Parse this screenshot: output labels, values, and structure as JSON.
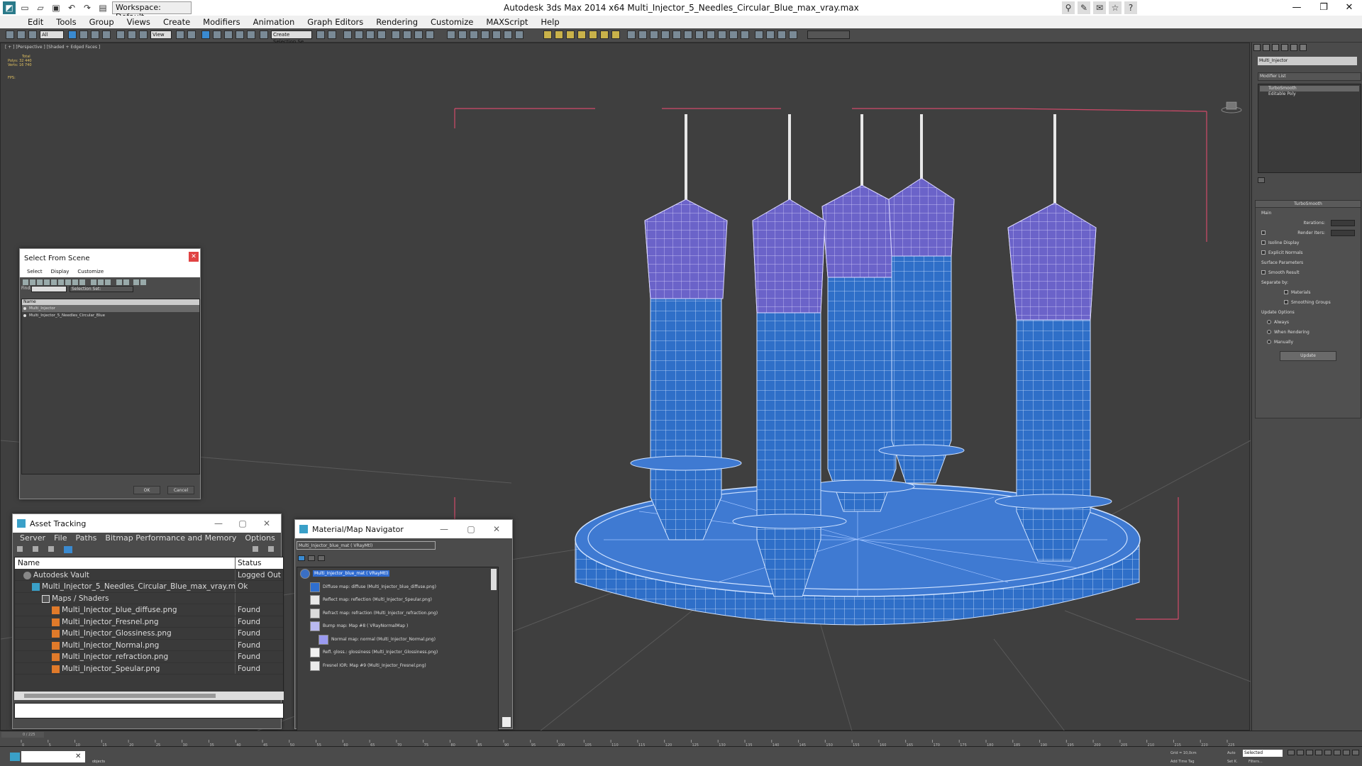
{
  "app": {
    "title": "Autodesk 3ds Max  2014 x64    Multi_Injector_5_Needles_Circular_Blue_max_vray.max",
    "workspace": "Workspace: Default"
  },
  "menu": [
    "Edit",
    "Tools",
    "Group",
    "Views",
    "Create",
    "Modifiers",
    "Animation",
    "Graph Editors",
    "Rendering",
    "Customize",
    "MAXScript",
    "Help"
  ],
  "toolbar": {
    "selection_filter": "All",
    "view": "View",
    "named_sets": "Create Selection Se"
  },
  "viewport": {
    "label": "[ + ] [Perspective ] [Shaded + Edged Faces ]",
    "stats": {
      "total": "Total",
      "polys": "Polys:  32 440",
      "verts": "Verts:  16 740",
      "fps": "FPS:"
    }
  },
  "command_panel": {
    "object_name": "Multi_Injector",
    "modifier_list": "Modifier List",
    "stack": [
      "TurboSmooth",
      "Editable Poly"
    ],
    "turbosmooth": {
      "title": "TurboSmooth",
      "main": "Main",
      "iterations": "Iterations:",
      "render_iters": "Render Iters:",
      "isoline": "Isoline Display",
      "explicit": "Explicit Normals",
      "surface": "Surface Parameters",
      "smooth": "Smooth Result",
      "separate": "Separate by:",
      "materials": "Materials",
      "groups": "Smoothing Groups",
      "update_options": "Update Options",
      "always": "Always",
      "when_rendering": "When Rendering",
      "manually": "Manually",
      "update": "Update"
    }
  },
  "select_from_scene": {
    "title": "Select From Scene",
    "menu": [
      "Select",
      "Display",
      "Customize"
    ],
    "find": "Find:",
    "selection_set": "Selection Set:",
    "header": "Name",
    "items": [
      "Multi_Injector",
      "Multi_Injector_5_Needles_Circular_Blue"
    ],
    "ok": "OK",
    "cancel": "Cancel"
  },
  "asset_tracking": {
    "title": "Asset Tracking",
    "menu": [
      "Server",
      "File",
      "Paths",
      "Bitmap Performance and Memory",
      "Options"
    ],
    "headers": {
      "name": "Name",
      "status": "Status"
    },
    "rows": [
      {
        "name": "Autodesk Vault",
        "status": "Logged Out (A"
      },
      {
        "name": "Multi_Injector_5_Needles_Circular_Blue_max_vray.max",
        "status": "Ok"
      },
      {
        "name": "Maps / Shaders",
        "status": ""
      },
      {
        "name": "Multi_Injector_blue_diffuse.png",
        "status": "Found"
      },
      {
        "name": "Multi_Injector_Fresnel.png",
        "status": "Found"
      },
      {
        "name": "Multi_Injector_Glossiness.png",
        "status": "Found"
      },
      {
        "name": "Multi_Injector_Normal.png",
        "status": "Found"
      },
      {
        "name": "Multi_Injector_refraction.png",
        "status": "Found"
      },
      {
        "name": "Multi_Injector_Speular.png",
        "status": "Found"
      }
    ]
  },
  "material_navigator": {
    "title": "Material/Map Navigator",
    "current": "Multi_Injector_blue_mat  ( VRayMtl)",
    "rows": [
      {
        "label": "Multi_Injector_blue_mat  ( VRayMtl)",
        "color": "#3a6fc4"
      },
      {
        "label": "Diffuse map: diffuse (Multi_Injector_blue_diffuse.png)",
        "color": "#2f6fd0"
      },
      {
        "label": "Reflect map: reflection (Multi_Injector_Speular.png)",
        "color": "#e8e8e8"
      },
      {
        "label": "Refract map: refraction (Multi_Injector_refraction.png)",
        "color": "#dcdcdc"
      },
      {
        "label": "Bump map: Map #8  ( VRayNormalMap )",
        "color": "#b9b9f0"
      },
      {
        "label": "Normal map: normal (Multi_Injector_Normal.png)",
        "color": "#9a9af0"
      },
      {
        "label": "Refl. gloss.: glossiness (Multi_Injector_Glossiness.png)",
        "color": "#f0f0f0"
      },
      {
        "label": "Fresnel IOR: Map #9 (Multi_Injector_Fresnel.png)",
        "color": "#ececec"
      }
    ]
  },
  "timeline": {
    "frame": "0 / 225",
    "ticks": [
      "0",
      "5",
      "10",
      "15",
      "20",
      "25",
      "30",
      "35",
      "40",
      "45",
      "50",
      "55",
      "60",
      "65",
      "70",
      "75",
      "80",
      "85",
      "90",
      "95",
      "100",
      "105",
      "110",
      "115",
      "120",
      "125",
      "130",
      "135",
      "140",
      "145",
      "150",
      "155",
      "160",
      "165",
      "170",
      "175",
      "180",
      "185",
      "190",
      "195",
      "200",
      "205",
      "210",
      "215",
      "220",
      "225"
    ]
  },
  "status": {
    "message": "None Selected",
    "objects": "objects",
    "grid": "Grid = 10,0cm",
    "auto": "Auto",
    "selected": "Selected",
    "set_key": "Set K.",
    "filters": "Filters...",
    "add_time_tag": "Add Time Tag"
  },
  "colors": {
    "syringe_blue": "#2f6fc8",
    "cap_purple": "#6b63c9",
    "bbox": "#d04a6a"
  }
}
